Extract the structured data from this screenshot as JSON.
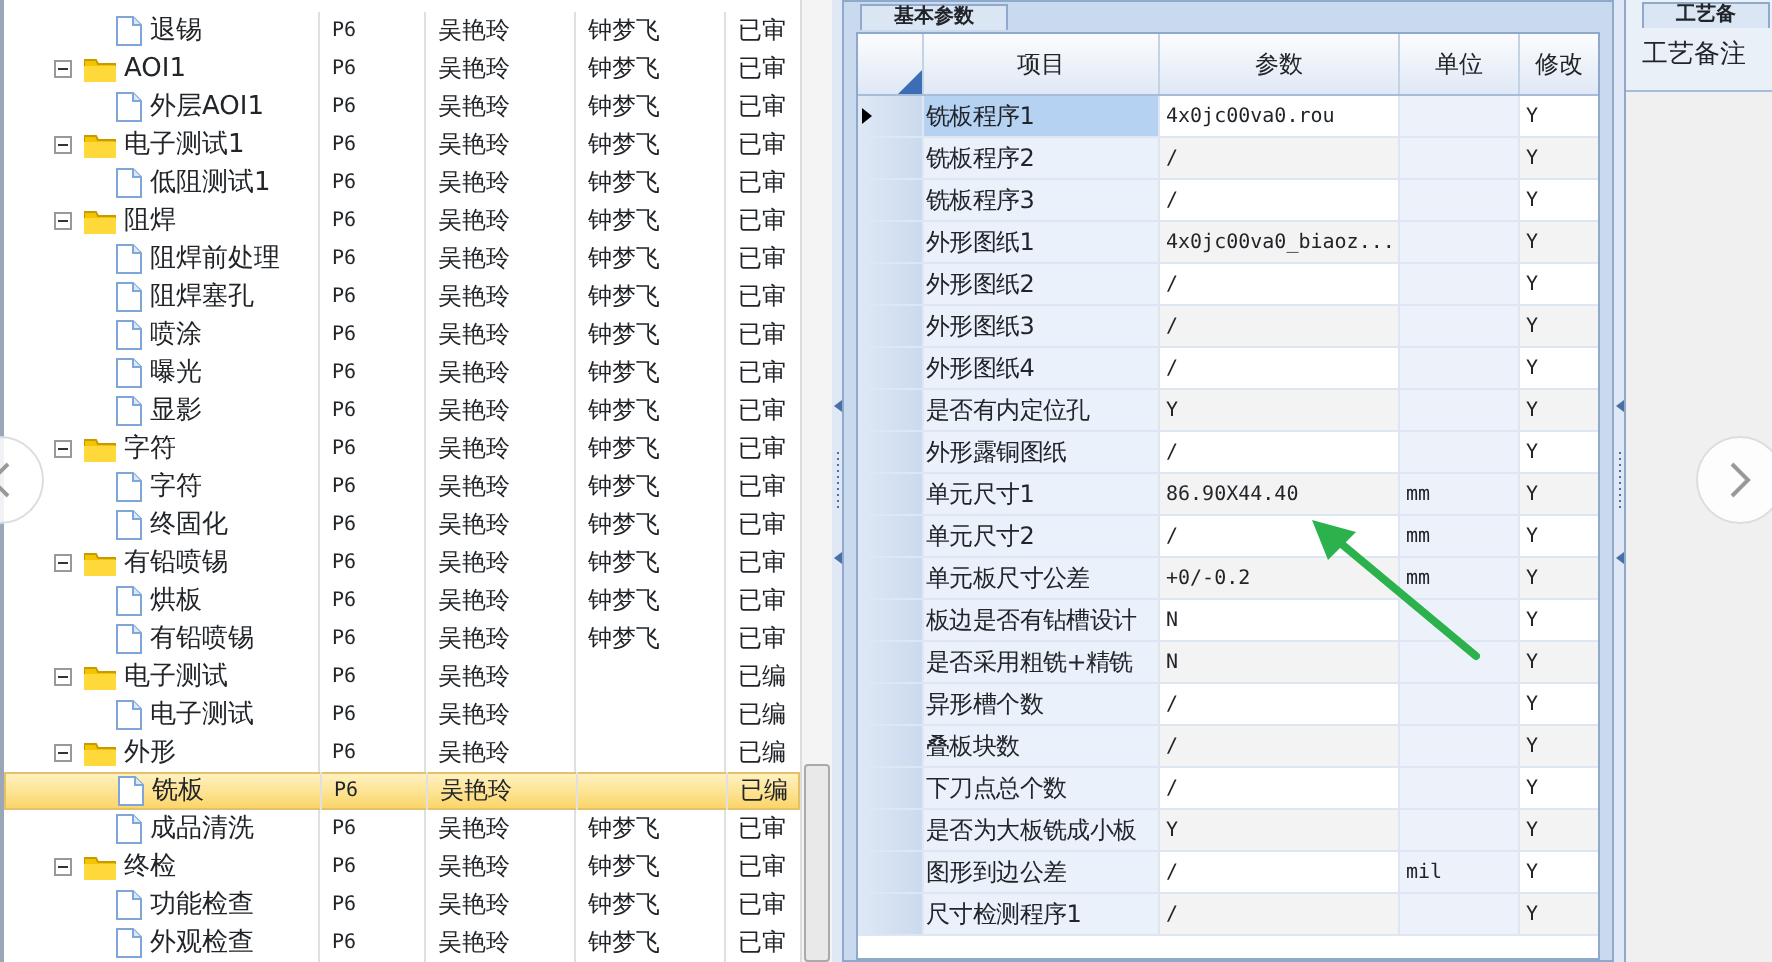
{
  "tree": {
    "rows": [
      {
        "children": [
          {
            "name": "退锡",
            "kind": "file",
            "selected": false,
            "column_2": "P6",
            "column_3": "吴艳玲",
            "column_4": "钟梦飞",
            "column_5": "已审"
          }
        ]
      },
      {
        "name": "AOI1",
        "kind": "folder",
        "selected": false,
        "column_2": "P6",
        "column_3": "吴艳玲",
        "column_4": "钟梦飞",
        "column_5": "已审",
        "children": [
          {
            "name": "外层AOI1",
            "kind": "file",
            "selected": false,
            "column_2": "P6",
            "column_3": "吴艳玲",
            "column_4": "钟梦飞",
            "column_5": "已审"
          }
        ]
      },
      {
        "name": "电子测试1",
        "kind": "folder",
        "selected": false,
        "column_2": "P6",
        "column_3": "吴艳玲",
        "column_4": "钟梦飞",
        "column_5": "已审",
        "children": [
          {
            "name": "低阻测试1",
            "kind": "file",
            "selected": false,
            "column_2": "P6",
            "column_3": "吴艳玲",
            "column_4": "钟梦飞",
            "column_5": "已审"
          }
        ]
      },
      {
        "name": "阻焊",
        "kind": "folder",
        "selected": false,
        "column_2": "P6",
        "column_3": "吴艳玲",
        "column_4": "钟梦飞",
        "column_5": "已审",
        "children": [
          {
            "name": "阻焊前处理",
            "kind": "file",
            "selected": false,
            "column_2": "P6",
            "column_3": "吴艳玲",
            "column_4": "钟梦飞",
            "column_5": "已审"
          },
          {
            "name": "阻焊塞孔",
            "kind": "file",
            "selected": false,
            "column_2": "P6",
            "column_3": "吴艳玲",
            "column_4": "钟梦飞",
            "column_5": "已审"
          },
          {
            "name": "喷涂",
            "kind": "file",
            "selected": false,
            "column_2": "P6",
            "column_3": "吴艳玲",
            "column_4": "钟梦飞",
            "column_5": "已审"
          },
          {
            "name": "曝光",
            "kind": "file",
            "selected": false,
            "column_2": "P6",
            "column_3": "吴艳玲",
            "column_4": "钟梦飞",
            "column_5": "已审"
          },
          {
            "name": "显影",
            "kind": "file",
            "selected": false,
            "column_2": "P6",
            "column_3": "吴艳玲",
            "column_4": "钟梦飞",
            "column_5": "已审"
          }
        ]
      },
      {
        "name": "字符",
        "kind": "folder",
        "selected": false,
        "column_2": "P6",
        "column_3": "吴艳玲",
        "column_4": "钟梦飞",
        "column_5": "已审",
        "children": [
          {
            "name": "字符",
            "kind": "file",
            "selected": false,
            "column_2": "P6",
            "column_3": "吴艳玲",
            "column_4": "钟梦飞",
            "column_5": "已审"
          },
          {
            "name": "终固化",
            "kind": "file",
            "selected": false,
            "column_2": "P6",
            "column_3": "吴艳玲",
            "column_4": "钟梦飞",
            "column_5": "已审"
          }
        ]
      },
      {
        "name": "有铅喷锡",
        "kind": "folder",
        "selected": false,
        "column_2": "P6",
        "column_3": "吴艳玲",
        "column_4": "钟梦飞",
        "column_5": "已审",
        "children": [
          {
            "name": "烘板",
            "kind": "file",
            "selected": false,
            "column_2": "P6",
            "column_3": "吴艳玲",
            "column_4": "钟梦飞",
            "column_5": "已审"
          },
          {
            "name": "有铅喷锡",
            "kind": "file",
            "selected": false,
            "column_2": "P6",
            "column_3": "吴艳玲",
            "column_4": "钟梦飞",
            "column_5": "已审"
          }
        ]
      },
      {
        "name": "电子测试",
        "kind": "folder",
        "selected": false,
        "column_2": "P6",
        "column_3": "吴艳玲",
        "column_5": "已编",
        "children": [
          {
            "name": "电子测试",
            "kind": "file",
            "selected": false,
            "column_2": "P6",
            "column_3": "吴艳玲",
            "column_5": "已编"
          }
        ]
      },
      {
        "name": "外形",
        "kind": "folder",
        "selected": false,
        "column_2": "P6",
        "column_3": "吴艳玲",
        "column_5": "已编",
        "children": [
          {
            "name": "铣板",
            "kind": "file",
            "selected": true,
            "column_2": "P6",
            "column_3": "吴艳玲",
            "column_5": "已编"
          },
          {
            "name": "成品清洗",
            "kind": "file",
            "selected": false,
            "column_2": "P6",
            "column_3": "吴艳玲",
            "column_4": "钟梦飞",
            "column_5": "已审"
          }
        ]
      },
      {
        "name": "终检",
        "kind": "folder",
        "selected": false,
        "column_2": "P6",
        "column_3": "吴艳玲",
        "column_4": "钟梦飞",
        "column_5": "已审",
        "children": [
          {
            "name": "功能检查",
            "kind": "file",
            "selected": false,
            "column_2": "P6",
            "column_3": "吴艳玲",
            "column_4": "钟梦飞",
            "column_5": "已审"
          },
          {
            "name": "外观检查",
            "kind": "file",
            "selected": false,
            "column_2": "P6",
            "column_3": "吴艳玲",
            "column_4": "钟梦飞",
            "column_5": "已审"
          }
        ]
      }
    ]
  },
  "params": {
    "tab": "基本参数",
    "columns": [
      "项目",
      "参数",
      "单位",
      "修改"
    ],
    "rows": [
      {
        "item": "铣板程序1",
        "value": "4x0jc00va0.rou",
        "unit": "",
        "modify": "Y",
        "selected": true
      },
      {
        "item": "铣板程序2",
        "value": "/",
        "unit": "",
        "modify": "Y",
        "selected": false
      },
      {
        "item": "铣板程序3",
        "value": "/",
        "unit": "",
        "modify": "Y",
        "selected": false
      },
      {
        "item": "外形图纸1",
        "value": "4x0jc00va0_biaoz...",
        "unit": "",
        "modify": "Y",
        "selected": false
      },
      {
        "item": "外形图纸2",
        "value": "/",
        "unit": "",
        "modify": "Y",
        "selected": false
      },
      {
        "item": "外形图纸3",
        "value": "/",
        "unit": "",
        "modify": "Y",
        "selected": false
      },
      {
        "item": "外形图纸4",
        "value": "/",
        "unit": "",
        "modify": "Y",
        "selected": false
      },
      {
        "item": "是否有内定位孔",
        "value": "Y",
        "unit": "",
        "modify": "Y",
        "selected": false
      },
      {
        "item": "外形露铜图纸",
        "value": "/",
        "unit": "",
        "modify": "Y",
        "selected": false
      },
      {
        "item": "单元尺寸1",
        "value": "86.90X44.40",
        "unit": "mm",
        "modify": "Y",
        "selected": false
      },
      {
        "item": "单元尺寸2",
        "value": "/",
        "unit": "mm",
        "modify": "Y",
        "selected": false
      },
      {
        "item": "单元板尺寸公差",
        "value": "+0/-0.2",
        "unit": "mm",
        "modify": "Y",
        "selected": false
      },
      {
        "item": "板边是否有钻槽设计",
        "value": "N",
        "unit": "",
        "modify": "Y",
        "selected": false
      },
      {
        "item": "是否采用粗铣+精铣",
        "value": "N",
        "unit": "",
        "modify": "Y",
        "selected": false
      },
      {
        "item": "异形槽个数",
        "value": "/",
        "unit": "",
        "modify": "Y",
        "selected": false
      },
      {
        "item": "叠板块数",
        "value": "/",
        "unit": "",
        "modify": "Y",
        "selected": false
      },
      {
        "item": "下刀点总个数",
        "value": "/",
        "unit": "",
        "modify": "Y",
        "selected": false
      },
      {
        "item": "是否为大板铣成小板",
        "value": "Y",
        "unit": "",
        "modify": "Y",
        "selected": false
      },
      {
        "item": "图形到边公差",
        "value": "/",
        "unit": "mil",
        "modify": "Y",
        "selected": false
      },
      {
        "item": "尺寸检测程序1",
        "value": "/",
        "unit": "",
        "modify": "Y",
        "selected": false
      }
    ]
  },
  "notes": {
    "tab": "工艺备",
    "label": "工艺备注"
  }
}
